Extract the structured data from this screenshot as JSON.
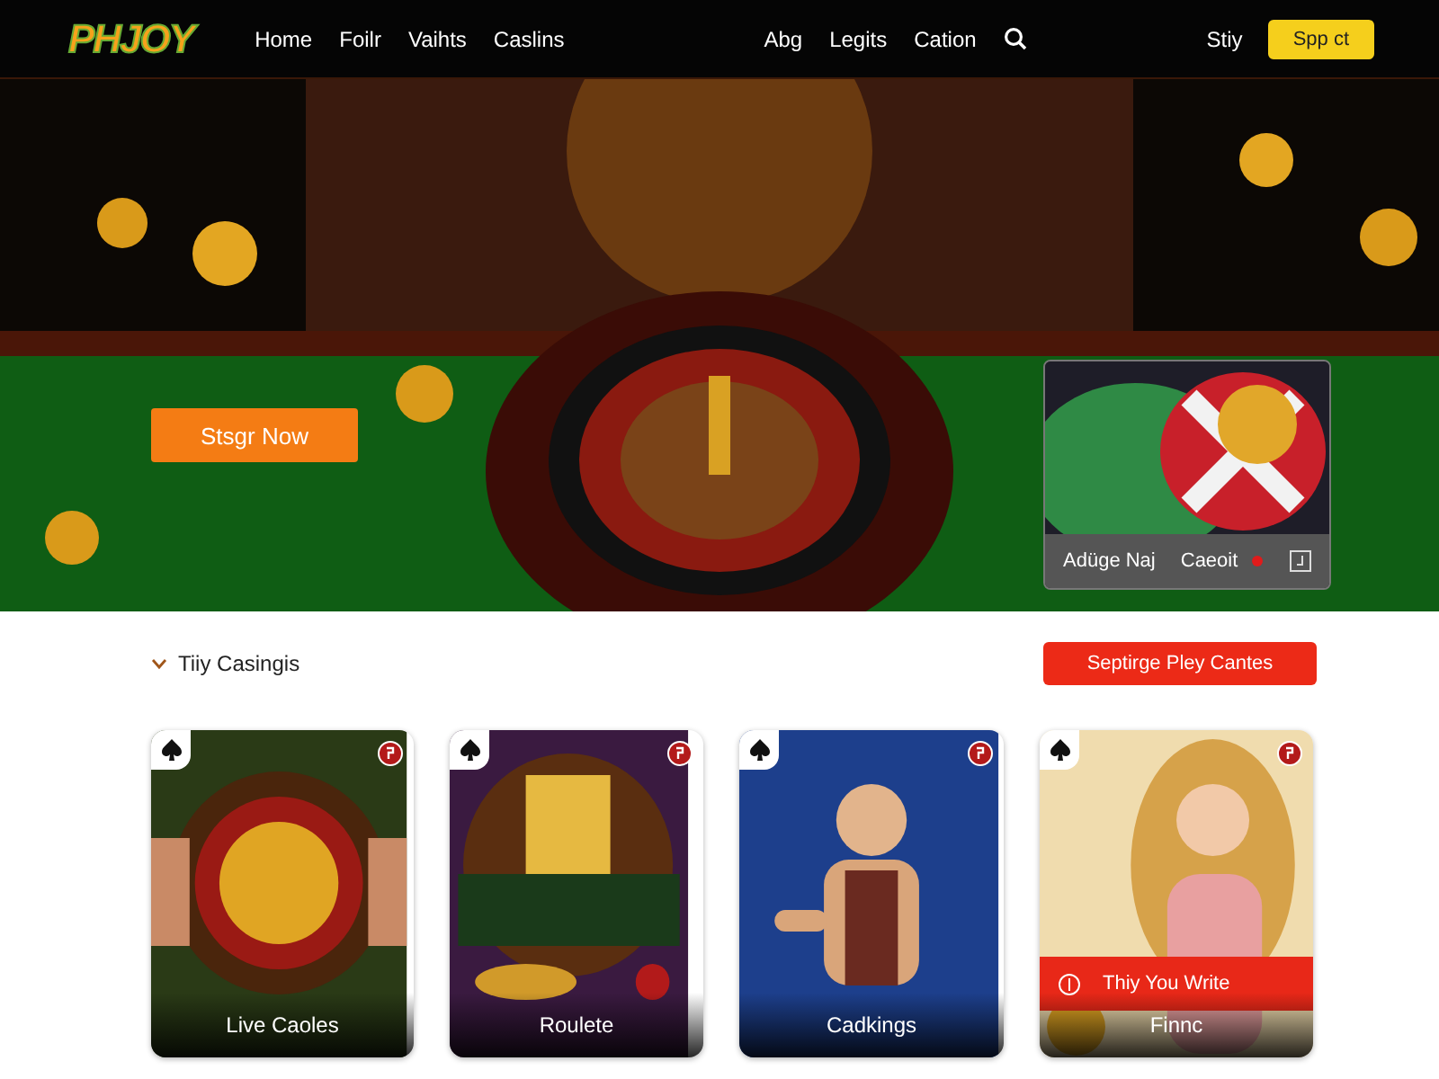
{
  "header": {
    "logo": "PHJOY",
    "nav_left": [
      "Home",
      "Foilr",
      "Vaihts",
      "Caslins"
    ],
    "nav_right": [
      "Abg",
      "Legits",
      "Cation"
    ],
    "link": "Stiy",
    "button": "Spp ct"
  },
  "hero": {
    "button": "Stsgr Now",
    "promo": {
      "kind": "picture",
      "label": "Adüge Naj",
      "action": "Caeoit"
    }
  },
  "section": {
    "title": "Tiiy Casingis",
    "button": "Septirge Pley Cantes"
  },
  "cards": [
    {
      "kind": "picture",
      "label": "Live Caoles"
    },
    {
      "kind": "picture",
      "label": "Roulete"
    },
    {
      "kind": "picture",
      "label": "Cadkings"
    },
    {
      "kind": "picture",
      "banner": "Thiy You Write",
      "label": "Finnc"
    }
  ]
}
